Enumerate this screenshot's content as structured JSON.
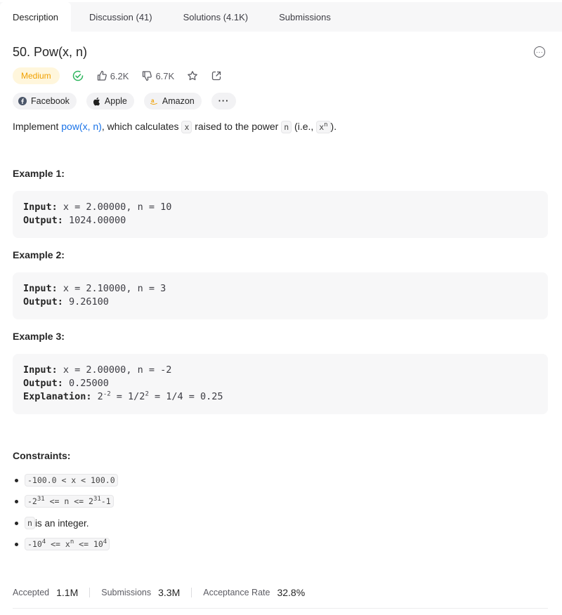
{
  "tabs": [
    {
      "label": "Description"
    },
    {
      "label": "Discussion (41)"
    },
    {
      "label": "Solutions (4.1K)"
    },
    {
      "label": "Submissions"
    }
  ],
  "problem": {
    "title": "50. Pow(x, n)",
    "difficulty": "Medium",
    "likes": "6.2K",
    "dislikes": "6.7K"
  },
  "companies": [
    "Facebook",
    "Apple",
    "Amazon"
  ],
  "more_companies": "···",
  "description": {
    "prefix": "Implement ",
    "link": "pow(x, n)",
    "middle1": ", which calculates ",
    "var_x": "x",
    "middle2": " raised to the power ",
    "var_n": "n",
    "middle3": " (i.e., ",
    "power_base": "x",
    "power_exp": "n",
    "suffix": ")."
  },
  "examples": [
    {
      "title": "Example 1:",
      "input_label": "Input:",
      "input": " x = 2.00000, n = 10",
      "output_label": "Output:",
      "output": " 1024.00000"
    },
    {
      "title": "Example 2:",
      "input_label": "Input:",
      "input": " x = 2.10000, n = 3",
      "output_label": "Output:",
      "output": " 9.26100"
    },
    {
      "title": "Example 3:",
      "input_label": "Input:",
      "input": " x = 2.00000, n = -2",
      "output_label": "Output:",
      "output": " 0.25000",
      "explanation_label": "Explanation:",
      "expl_base1": " 2",
      "expl_exp1": "-2",
      "expl_mid": " = 1/2",
      "expl_exp2": "2",
      "expl_end": " = 1/4 = 0.25"
    }
  ],
  "constraints_title": "Constraints:",
  "constraints": {
    "c1": "-100.0 < x < 100.0",
    "c2_a": "-2",
    "c2_exp1": "31",
    "c2_b": " <= n <= 2",
    "c2_exp2": "31",
    "c2_c": "-1",
    "c3_code": "n",
    "c3_text": " is an integer.",
    "c4_a": "-10",
    "c4_exp1": "4",
    "c4_b": " <= x",
    "c4_exp2": "n",
    "c4_c": " <= 10",
    "c4_exp3": "4"
  },
  "stats": {
    "accepted_label": "Accepted",
    "accepted_value": "1.1M",
    "submissions_label": "Submissions",
    "submissions_value": "3.3M",
    "rate_label": "Acceptance Rate",
    "rate_value": "32.8%"
  },
  "colors": {
    "link": "#1a73e8",
    "medium": "#f0a000",
    "solved": "#2db55d"
  }
}
